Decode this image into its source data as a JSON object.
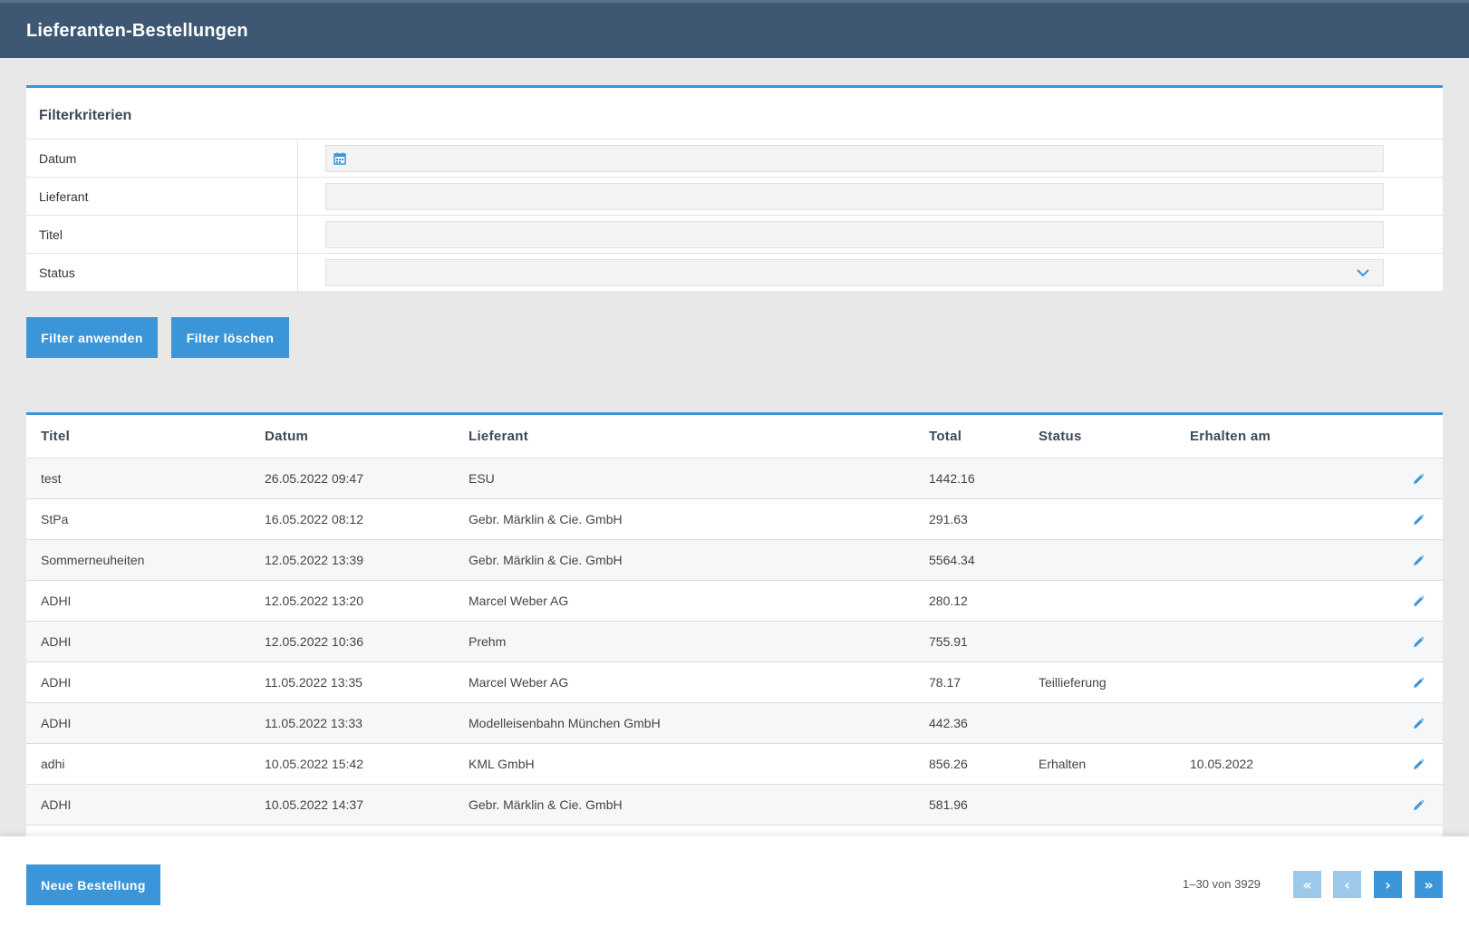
{
  "header": {
    "title": "Lieferanten-Bestellungen"
  },
  "filter": {
    "title": "Filterkriterien",
    "fields": [
      {
        "label": "Datum",
        "value": ""
      },
      {
        "label": "Lieferant",
        "value": ""
      },
      {
        "label": "Titel",
        "value": ""
      },
      {
        "label": "Status",
        "value": ""
      }
    ],
    "apply_label": "Filter anwenden",
    "clear_label": "Filter löschen"
  },
  "table": {
    "columns": [
      "Titel",
      "Datum",
      "Lieferant",
      "Total",
      "Status",
      "Erhalten am"
    ],
    "rows": [
      [
        "test",
        "26.05.2022 09:47",
        "ESU",
        "1442.16",
        "",
        ""
      ],
      [
        "StPa",
        "16.05.2022 08:12",
        "Gebr. Märklin & Cie. GmbH",
        "291.63",
        "",
        ""
      ],
      [
        "Sommerneuheiten",
        "12.05.2022 13:39",
        "Gebr. Märklin & Cie. GmbH",
        "5564.34",
        "",
        ""
      ],
      [
        "ADHI",
        "12.05.2022 13:20",
        "Marcel Weber AG",
        "280.12",
        "",
        ""
      ],
      [
        "ADHI",
        "12.05.2022 10:36",
        "Prehm",
        "755.91",
        "",
        ""
      ],
      [
        "ADHI",
        "11.05.2022 13:35",
        "Marcel Weber AG",
        "78.17",
        "Teillieferung",
        ""
      ],
      [
        "ADHI",
        "11.05.2022 13:33",
        "Modelleisenbahn München GmbH",
        "442.36",
        "",
        ""
      ],
      [
        "adhi",
        "10.05.2022 15:42",
        "KML GmbH",
        "856.26",
        "Erhalten",
        "10.05.2022"
      ],
      [
        "ADHI",
        "10.05.2022 14:37",
        "Gebr. Märklin & Cie. GmbH",
        "581.96",
        "",
        ""
      ],
      [
        "",
        "",
        "",
        "",
        "",
        ""
      ]
    ]
  },
  "footer": {
    "new_label": "Neue Bestellung",
    "pager_text": "1–30 von 3929",
    "first": "«",
    "prev": "‹",
    "next": "›",
    "last": "»"
  },
  "colors": {
    "header_bg": "#3e5873",
    "accent": "#3a96d8",
    "accent_disabled": "#9cc8ea"
  }
}
